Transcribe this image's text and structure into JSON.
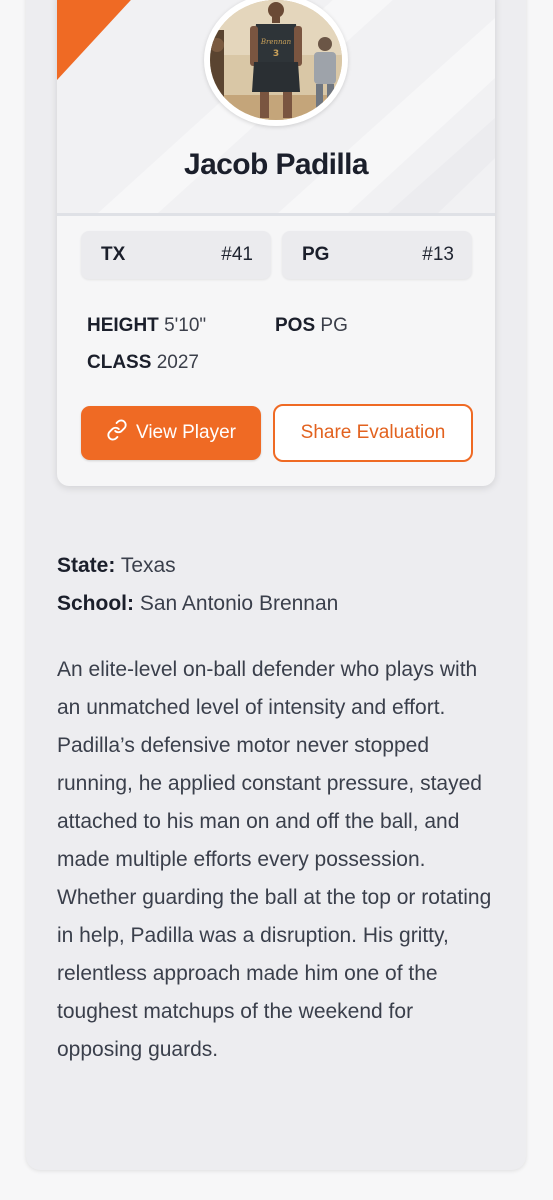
{
  "player": {
    "name": "Jacob Padilla",
    "state_code": "TX",
    "state_rank": "#41",
    "position_code": "PG",
    "position_rank": "#13",
    "height_label": "HEIGHT",
    "height": "5'10\"",
    "pos_label": "POS",
    "pos": "PG",
    "class_label": "CLASS",
    "class_year": "2027",
    "jersey_number": "3"
  },
  "actions": {
    "view_player": "View Player",
    "share_evaluation": "Share Evaluation"
  },
  "details": {
    "state_label": "State:",
    "state": "Texas",
    "school_label": "School:",
    "school": "San Antonio Brennan"
  },
  "evaluation": {
    "text": "An elite-level on-ball defender who plays with an unmatched level of intensity and effort. Padilla’s defensive motor never stopped running, he applied constant pressure, stayed attached to his man on and off the ball, and made multiple efforts every possession. Whether guarding the ball at the top or rotating in help, Padilla was a disruption. His gritty, relentless approach made him one of the toughest matchups of the weekend for opposing guards."
  },
  "icons": {
    "view_player": "link-icon"
  },
  "colors": {
    "accent": "#ef6a24",
    "text_dark": "#1b1f2b",
    "panel": "#ededf0"
  }
}
